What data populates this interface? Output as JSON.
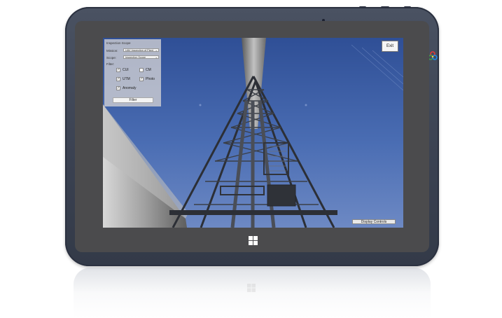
{
  "device": {
    "accent_colors": [
      "#e53935",
      "#43a047",
      "#1e88e5",
      "#fdd835"
    ]
  },
  "app": {
    "panel": {
      "title": "Inspection Scope",
      "rows": [
        {
          "label": "Mission:",
          "value": "UAV Inspection of Plant"
        },
        {
          "label": "Scope:",
          "value": "Inspection Scope"
        }
      ],
      "filter_label": "Filter:",
      "checkboxes": [
        {
          "label": "CUI",
          "checked": true
        },
        {
          "label": "CM",
          "checked": false
        },
        {
          "label": "UTM",
          "checked": true
        },
        {
          "label": "Photo",
          "checked": true
        },
        {
          "label": "Anomaly",
          "checked": true
        }
      ],
      "filter_button": "Filter"
    },
    "exit_button": "Exit",
    "display_controls_button": "Display Controls"
  },
  "icons": {
    "windows": "windows-logo-icon",
    "brand": "brand-logo-icon"
  }
}
